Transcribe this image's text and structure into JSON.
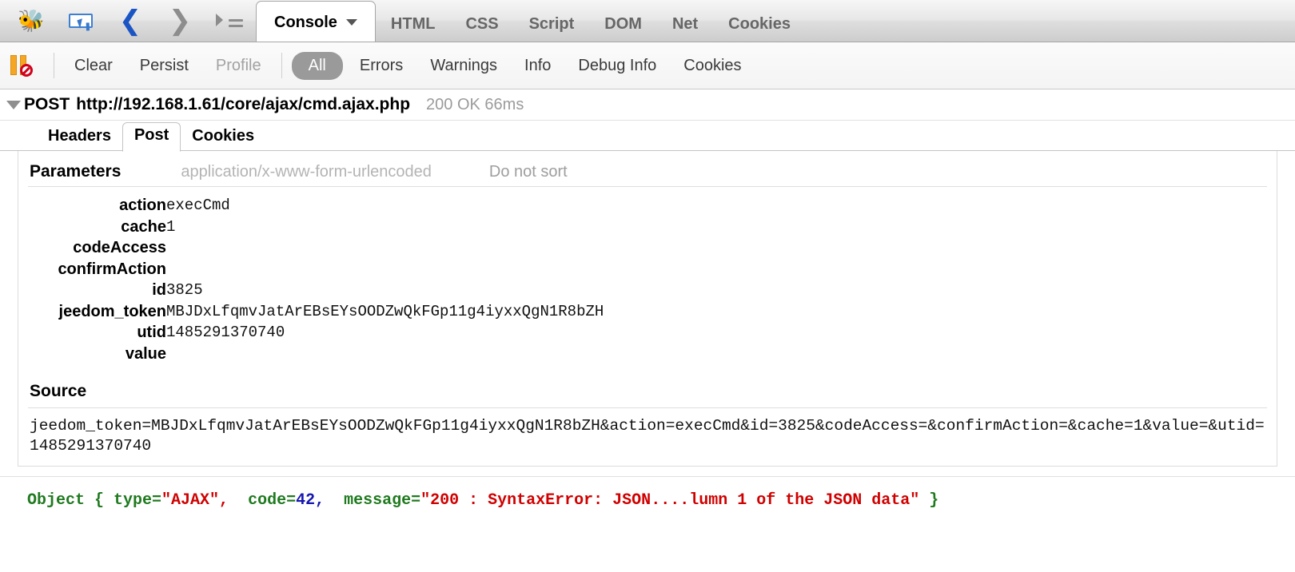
{
  "toolbar": {
    "icons": [
      {
        "name": "firebug-logo-icon",
        "glyph": "🐝"
      },
      {
        "name": "inspect-element-icon"
      },
      {
        "name": "back-arrow-icon",
        "glyph": "‹"
      },
      {
        "name": "forward-arrow-icon",
        "glyph": "›"
      },
      {
        "name": "panel-list-icon"
      }
    ],
    "tabs": [
      {
        "label": "Console",
        "active": true,
        "has_caret": true
      },
      {
        "label": "HTML",
        "active": false
      },
      {
        "label": "CSS",
        "active": false
      },
      {
        "label": "Script",
        "active": false
      },
      {
        "label": "DOM",
        "active": false
      },
      {
        "label": "Net",
        "active": false
      },
      {
        "label": "Cookies",
        "active": false
      }
    ]
  },
  "options_bar": {
    "break_on_error_icon": "break-on-error-icon",
    "items": [
      {
        "label": "Clear",
        "style": "normal"
      },
      {
        "label": "Persist",
        "style": "normal"
      },
      {
        "label": "Profile",
        "style": "dim"
      },
      {
        "label": "All",
        "style": "pill"
      },
      {
        "label": "Errors",
        "style": "normal"
      },
      {
        "label": "Warnings",
        "style": "normal"
      },
      {
        "label": "Info",
        "style": "normal"
      },
      {
        "label": "Debug Info",
        "style": "normal"
      },
      {
        "label": "Cookies",
        "style": "normal"
      }
    ]
  },
  "request": {
    "method": "POST",
    "url": "http://192.168.1.61/core/ajax/cmd.ajax.php",
    "status": "200 OK 66ms",
    "expanded": true
  },
  "sub_tabs": [
    {
      "label": "Headers",
      "active": false
    },
    {
      "label": "Post",
      "active": true
    },
    {
      "label": "Cookies",
      "active": false
    }
  ],
  "parameters_section": {
    "title": "Parameters",
    "content_type": "application/x-www-form-urlencoded",
    "sort_label": "Do not sort",
    "rows": [
      {
        "name": "action",
        "value": "execCmd"
      },
      {
        "name": "cache",
        "value": "1"
      },
      {
        "name": "codeAccess",
        "value": ""
      },
      {
        "name": "confirmAction",
        "value": ""
      },
      {
        "name": "id",
        "value": "3825"
      },
      {
        "name": "jeedom_token",
        "value": "MBJDxLfqmvJatArEBsEYsOODZwQkFGp11g4iyxxQgN1R8bZH"
      },
      {
        "name": "utid",
        "value": "1485291370740"
      },
      {
        "name": "value",
        "value": ""
      }
    ]
  },
  "source_section": {
    "title": "Source",
    "body": "jeedom_token=MBJDxLfqmvJatArEBsEYsOODZwQkFGp11g4iyxxQgN1R8bZH&action=execCmd&id=3825&codeAccess=&confirmAction=&cache=1&value=&utid=1485291370740"
  },
  "console_log": {
    "object_label": "Object {",
    "type_key": "type=",
    "type_value": "\"AJAX\",",
    "code_key": "code=",
    "code_value": "42,",
    "message_key": "message=",
    "message_value": "\"200 : SyntaxError: JSON....lumn 1 of the JSON data\"",
    "closing": "}",
    "colors": {
      "label": "#1f7a1f",
      "string": "#d00000",
      "number": "#1616b0"
    }
  }
}
